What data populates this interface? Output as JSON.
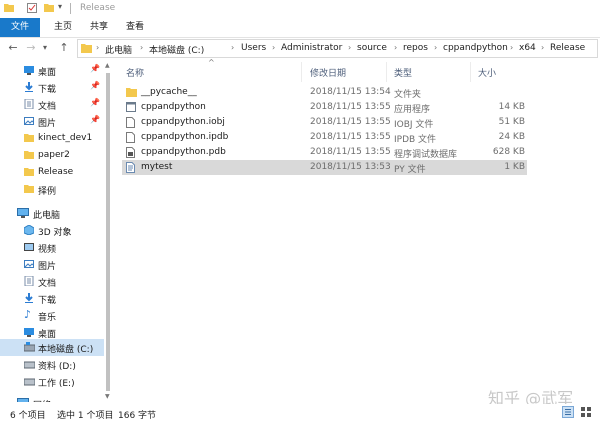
{
  "title_bar": {
    "title": "Release"
  },
  "ribbon": {
    "tabs": [
      "文件",
      "主页",
      "共享",
      "查看"
    ]
  },
  "address": {
    "crumbs": [
      "此电脑",
      "本地磁盘 (C:)",
      "Users",
      "Administrator",
      "source",
      "repos",
      "cppandpython",
      "x64",
      "Release"
    ]
  },
  "nav": {
    "quick_access": [
      {
        "label": "桌面",
        "icon": "desktop-icon",
        "pinned": true
      },
      {
        "label": "下载",
        "icon": "download-icon",
        "pinned": true
      },
      {
        "label": "文档",
        "icon": "documents-icon",
        "pinned": true
      },
      {
        "label": "图片",
        "icon": "pictures-icon",
        "pinned": true
      },
      {
        "label": "kinect_dev1",
        "icon": "folder-icon",
        "pinned": false
      },
      {
        "label": "paper2",
        "icon": "folder-icon",
        "pinned": false
      },
      {
        "label": "Release",
        "icon": "folder-icon",
        "pinned": false
      },
      {
        "label": "择例",
        "icon": "folder-icon",
        "pinned": false
      }
    ],
    "this_pc": "此电脑",
    "pc_items": [
      {
        "label": "3D 对象",
        "icon": "3d-objects-icon"
      },
      {
        "label": "视频",
        "icon": "videos-icon"
      },
      {
        "label": "图片",
        "icon": "pictures-icon"
      },
      {
        "label": "文档",
        "icon": "documents-icon"
      },
      {
        "label": "下载",
        "icon": "download-icon"
      },
      {
        "label": "音乐",
        "icon": "music-icon"
      },
      {
        "label": "桌面",
        "icon": "desktop-icon"
      },
      {
        "label": "本地磁盘 (C:)",
        "icon": "drive-icon"
      },
      {
        "label": "资料 (D:)",
        "icon": "drive-icon"
      },
      {
        "label": "工作 (E:)",
        "icon": "drive-icon"
      }
    ],
    "network": "网络"
  },
  "list": {
    "columns": {
      "name": "名称",
      "date": "修改日期",
      "type": "类型",
      "size": "大小"
    },
    "files": [
      {
        "name": "__pycache__",
        "date": "2018/11/15 13:54",
        "type": "文件夹",
        "size": "",
        "icon": "folder-icon"
      },
      {
        "name": "cppandpython",
        "date": "2018/11/15 13:55",
        "type": "应用程序",
        "size": "14 KB",
        "icon": "application-icon"
      },
      {
        "name": "cppandpython.iobj",
        "date": "2018/11/15 13:55",
        "type": "IOBJ 文件",
        "size": "51 KB",
        "icon": "file-icon"
      },
      {
        "name": "cppandpython.ipdb",
        "date": "2018/11/15 13:55",
        "type": "IPDB 文件",
        "size": "24 KB",
        "icon": "file-icon"
      },
      {
        "name": "cppandpython.pdb",
        "date": "2018/11/15 13:55",
        "type": "程序调试数据库",
        "size": "628 KB",
        "icon": "pdb-file-icon"
      },
      {
        "name": "mytest",
        "date": "2018/11/15 13:53",
        "type": "PY 文件",
        "size": "1 KB",
        "icon": "python-file-icon"
      }
    ]
  },
  "status": {
    "count": "6 个项目",
    "selected": "选中 1 个项目",
    "size": "166 字节"
  },
  "watermark": "知乎 @武军",
  "colors": {
    "accent": "#1979ca",
    "folder": "#f3c84d",
    "selection": "#cce1f5"
  }
}
